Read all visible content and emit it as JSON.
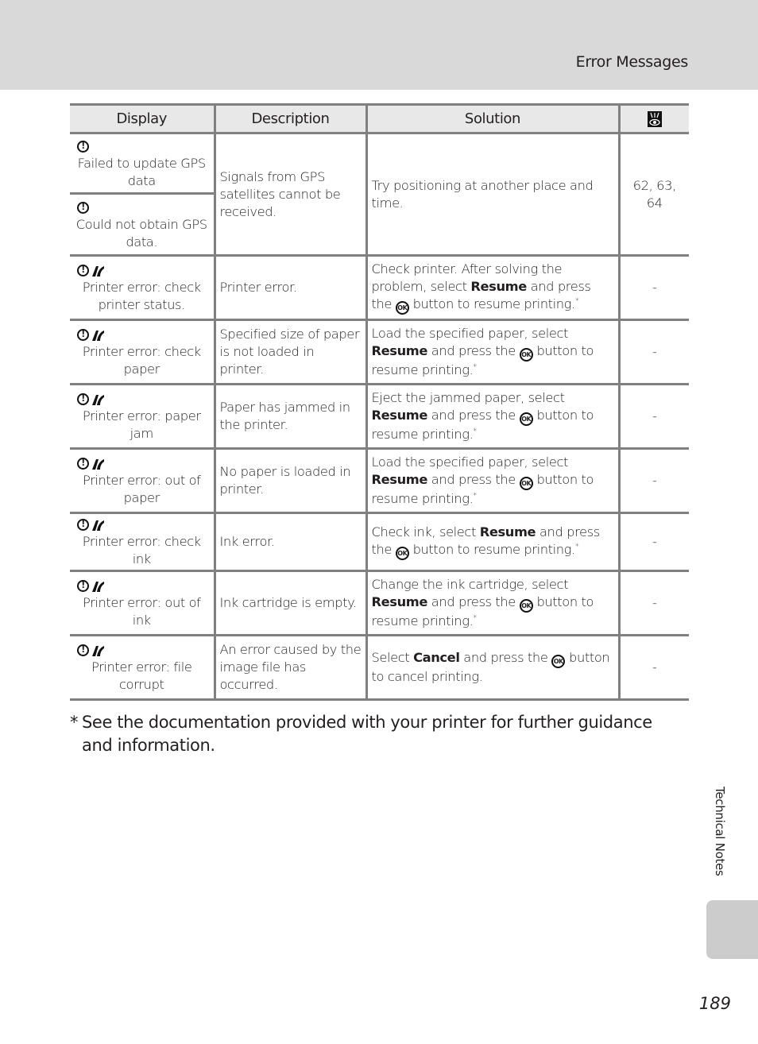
{
  "header": {
    "section_title": "Error Messages"
  },
  "table": {
    "columns": [
      "Display",
      "Description",
      "Solution",
      "reference-icon"
    ],
    "rows": [
      {
        "displays": [
          {
            "icons": [
              "alert"
            ],
            "text": "Failed to update GPS data"
          },
          {
            "icons": [
              "alert"
            ],
            "text": "Could not obtain GPS data."
          }
        ],
        "description": "Signals from GPS satellites cannot be received.",
        "solution": [
          {
            "t": "Try positioning at another place and time."
          }
        ],
        "ref": "62, 63, 64"
      },
      {
        "displays": [
          {
            "icons": [
              "alert",
              "printer"
            ],
            "text": "Printer error: check printer status."
          }
        ],
        "description": "Printer error.",
        "solution": [
          {
            "t": "Check printer. After solving the problem, select "
          },
          {
            "b": "Resume"
          },
          {
            "t": " and press the "
          },
          {
            "ok": "OK"
          },
          {
            "t": " button to resume printing."
          },
          {
            "star": "*"
          }
        ],
        "ref": "-"
      },
      {
        "displays": [
          {
            "icons": [
              "alert",
              "printer"
            ],
            "text": "Printer error: check paper"
          }
        ],
        "description": "Specified size of paper is not loaded in printer.",
        "solution": [
          {
            "t": "Load the specified paper, select "
          },
          {
            "b": "Resume"
          },
          {
            "t": " and press the "
          },
          {
            "ok": "OK"
          },
          {
            "t": " button to resume printing."
          },
          {
            "star": "*"
          }
        ],
        "ref": "-"
      },
      {
        "displays": [
          {
            "icons": [
              "alert",
              "printer"
            ],
            "text": "Printer error: paper jam"
          }
        ],
        "description": "Paper has jammed in the printer.",
        "solution": [
          {
            "t": "Eject the jammed paper, select "
          },
          {
            "b": "Resume"
          },
          {
            "t": " and press the "
          },
          {
            "ok": "OK"
          },
          {
            "t": " button to resume printing."
          },
          {
            "star": "*"
          }
        ],
        "ref": "-"
      },
      {
        "displays": [
          {
            "icons": [
              "alert",
              "printer"
            ],
            "text": "Printer error: out of paper"
          }
        ],
        "description": "No paper is loaded in printer.",
        "solution": [
          {
            "t": "Load the specified paper, select "
          },
          {
            "b": "Resume"
          },
          {
            "t": " and press the "
          },
          {
            "ok": "OK"
          },
          {
            "t": " button to resume printing."
          },
          {
            "star": "*"
          }
        ],
        "ref": "-"
      },
      {
        "displays": [
          {
            "icons": [
              "alert",
              "printer"
            ],
            "text": "Printer error: check ink"
          }
        ],
        "description": "Ink error.",
        "solution": [
          {
            "t": "Check ink, select "
          },
          {
            "b": "Resume"
          },
          {
            "t": " and press the "
          },
          {
            "ok": "OK"
          },
          {
            "t": " button to resume printing."
          },
          {
            "star": "*"
          }
        ],
        "ref": "-"
      },
      {
        "displays": [
          {
            "icons": [
              "alert",
              "printer"
            ],
            "text": "Printer error: out of ink"
          }
        ],
        "description": "Ink cartridge is empty.",
        "solution": [
          {
            "t": "Change the ink cartridge, select "
          },
          {
            "b": "Resume"
          },
          {
            "t": " and press the "
          },
          {
            "ok": "OK"
          },
          {
            "t": " button to resume printing."
          },
          {
            "star": "*"
          }
        ],
        "ref": "-"
      },
      {
        "displays": [
          {
            "icons": [
              "alert",
              "printer"
            ],
            "text": "Printer error: file corrupt"
          }
        ],
        "description": "An error caused by the image file has occurred.",
        "solution": [
          {
            "t": "Select "
          },
          {
            "b": "Cancel"
          },
          {
            "t": " and press the "
          },
          {
            "ok": "OK"
          },
          {
            "t": " button to cancel printing."
          }
        ],
        "ref": "-"
      }
    ]
  },
  "footnote": {
    "mark": "*",
    "text": "See the documentation provided with your printer for further guidance and information."
  },
  "side": {
    "label": "Technical Notes"
  },
  "page": {
    "number": "189"
  }
}
